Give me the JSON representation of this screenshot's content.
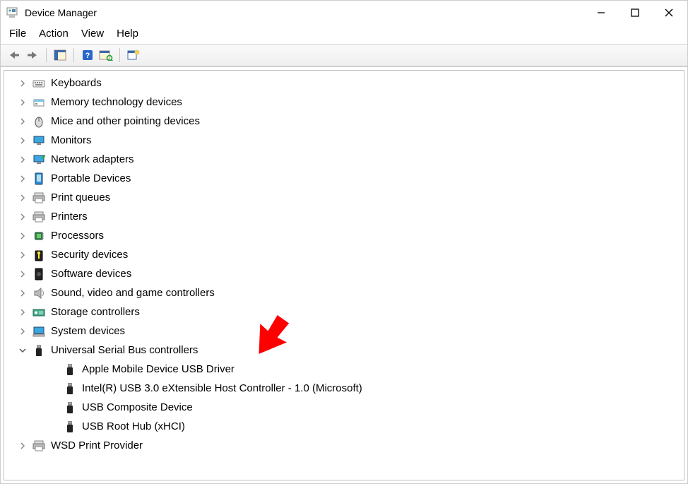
{
  "window": {
    "title": "Device Manager"
  },
  "menu": {
    "file": "File",
    "action": "Action",
    "view": "View",
    "help": "Help"
  },
  "toolbar": {
    "back": "back",
    "forward": "forward",
    "show_hide": "show-hide-console-tree",
    "help": "help",
    "scan": "scan-for-hardware-changes",
    "props": "properties"
  },
  "tree": {
    "nodes": [
      {
        "idx": 0,
        "label": "Keyboards",
        "icon": "keyboard-icon",
        "expanded": false
      },
      {
        "idx": 1,
        "label": "Memory technology devices",
        "icon": "card-icon",
        "expanded": false
      },
      {
        "idx": 2,
        "label": "Mice and other pointing devices",
        "icon": "mouse-icon",
        "expanded": false
      },
      {
        "idx": 3,
        "label": "Monitors",
        "icon": "monitor-icon",
        "expanded": false
      },
      {
        "idx": 4,
        "label": "Network adapters",
        "icon": "network-icon",
        "expanded": false
      },
      {
        "idx": 5,
        "label": "Portable Devices",
        "icon": "mobile-icon",
        "expanded": false
      },
      {
        "idx": 6,
        "label": "Print queues",
        "icon": "printer-icon",
        "expanded": false
      },
      {
        "idx": 7,
        "label": "Printers",
        "icon": "printer-icon",
        "expanded": false
      },
      {
        "idx": 8,
        "label": "Processors",
        "icon": "cpu-icon",
        "expanded": false
      },
      {
        "idx": 9,
        "label": "Security devices",
        "icon": "security-icon",
        "expanded": false
      },
      {
        "idx": 10,
        "label": "Software devices",
        "icon": "software-icon",
        "expanded": false
      },
      {
        "idx": 11,
        "label": "Sound, video and game controllers",
        "icon": "speaker-icon",
        "expanded": false
      },
      {
        "idx": 12,
        "label": "Storage controllers",
        "icon": "storage-icon",
        "expanded": false
      },
      {
        "idx": 13,
        "label": "System devices",
        "icon": "computer-icon",
        "expanded": false
      },
      {
        "idx": 14,
        "label": "Universal Serial Bus controllers",
        "icon": "usb-icon",
        "expanded": true,
        "children": [
          {
            "idx": 0,
            "label": "Apple Mobile Device USB Driver",
            "icon": "usb-icon"
          },
          {
            "idx": 1,
            "label": "Intel(R) USB 3.0 eXtensible Host Controller - 1.0 (Microsoft)",
            "icon": "usb-icon"
          },
          {
            "idx": 2,
            "label": "USB Composite Device",
            "icon": "usb-icon"
          },
          {
            "idx": 3,
            "label": "USB Root Hub (xHCI)",
            "icon": "usb-icon"
          }
        ]
      },
      {
        "idx": 15,
        "label": "WSD Print Provider",
        "icon": "printer-icon",
        "expanded": false
      }
    ]
  }
}
